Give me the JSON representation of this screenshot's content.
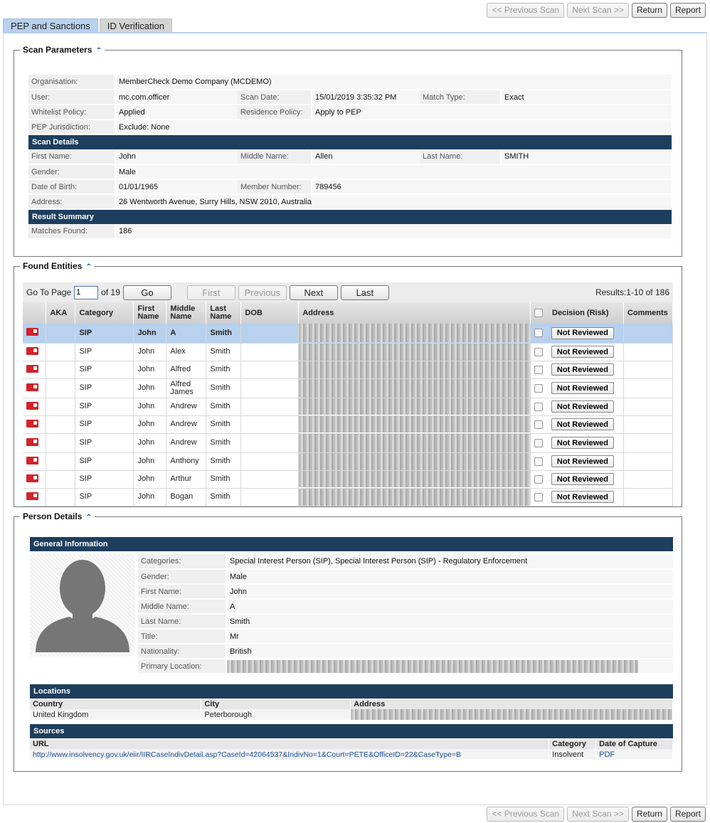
{
  "nav": {
    "previous_scan": "<< Previous Scan",
    "next_scan": "Next Scan >>",
    "return": "Return",
    "report": "Report"
  },
  "tabs": [
    {
      "label": "PEP and Sanctions",
      "active": true
    },
    {
      "label": "ID Verification",
      "active": false
    }
  ],
  "scan_parameters": {
    "legend": "Scan Parameters",
    "organisation_label": "Organisation:",
    "organisation": "MemberCheck Demo Company (MCDEMO)",
    "user_label": "User:",
    "user": "mc.com.officer",
    "scan_date_label": "Scan Date:",
    "scan_date": "15/01/2019 3:35:32 PM",
    "match_type_label": "Match Type:",
    "match_type": "Exact",
    "whitelist_label": "Whitelist Policy:",
    "whitelist": "Applied",
    "residence_label": "Residence Policy:",
    "residence": "Apply to PEP",
    "jurisdiction_label": "PEP Jurisdiction:",
    "jurisdiction": "Exclude: None",
    "scan_details_header": "Scan Details",
    "first_name_label": "First Name:",
    "first_name": "John",
    "middle_name_label": "Middle Name:",
    "middle_name": "Allen",
    "last_name_label": "Last Name:",
    "last_name": "SMITH",
    "gender_label": "Gender:",
    "gender": "Male",
    "dob_label": "Date of Birth:",
    "dob": "01/01/1965",
    "member_number_label": "Member Number:",
    "member_number": "789456",
    "address_label": "Address:",
    "address": "26 Wentworth Avenue, Surry Hills, NSW 2010, Australia",
    "result_summary_header": "Result Summary",
    "matches_label": "Matches Found:",
    "matches": "186"
  },
  "found_entities": {
    "legend": "Found Entities",
    "go_to_page_label": "Go To Page",
    "page_value": "1",
    "of_pages": "of 19",
    "go": "Go",
    "first": "First",
    "previous": "Previous",
    "next": "Next",
    "last": "Last",
    "results": "Results:1-10 of 186",
    "headers": {
      "aka": "AKA",
      "category": "Category",
      "first_name": "First Name",
      "middle_name": "Middle Name",
      "last_name": "Last Name",
      "dob": "DOB",
      "address": "Address",
      "decision": "Decision (Risk)",
      "comments": "Comments"
    },
    "decision_label": "Not Reviewed",
    "rows": [
      {
        "category": "SIP",
        "first": "John",
        "middle": "A",
        "last": "Smith"
      },
      {
        "category": "SIP",
        "first": "John",
        "middle": "Alex",
        "last": "Smith"
      },
      {
        "category": "SIP",
        "first": "John",
        "middle": "Alfred",
        "last": "Smith"
      },
      {
        "category": "SIP",
        "first": "John",
        "middle": "Alfred James",
        "last": "Smith"
      },
      {
        "category": "SIP",
        "first": "John",
        "middle": "Andrew",
        "last": "Smith"
      },
      {
        "category": "SIP",
        "first": "John",
        "middle": "Andrew",
        "last": "Smith"
      },
      {
        "category": "SIP",
        "first": "John",
        "middle": "Andrew",
        "last": "Smith"
      },
      {
        "category": "SIP",
        "first": "John",
        "middle": "Anthony",
        "last": "Smith"
      },
      {
        "category": "SIP",
        "first": "John",
        "middle": "Arthur",
        "last": "Smith"
      },
      {
        "category": "SIP",
        "first": "John",
        "middle": "Bogan",
        "last": "Smith"
      }
    ]
  },
  "person_details": {
    "legend": "Person Details",
    "general_header": "General Information",
    "categories_label": "Categories:",
    "categories": "Special Interest Person (SIP), Special Interest Person (SIP) - Regulatory Enforcement",
    "gender_label": "Gender:",
    "gender": "Male",
    "first_name_label": "First Name:",
    "first_name": "John",
    "middle_name_label": "Middle Name:",
    "middle_name": "A",
    "last_name_label": "Last Name:",
    "last_name": "Smith",
    "title_label": "Title:",
    "title": "Mr",
    "nationality_label": "Nationality:",
    "nationality": "British",
    "primary_location_label": "Primary Location:",
    "locations_header": "Locations",
    "loc_country_h": "Country",
    "loc_city_h": "City",
    "loc_address_h": "Address",
    "loc_country": "United Kingdom",
    "loc_city": "Peterborough",
    "sources_header": "Sources",
    "src_url_h": "URL",
    "src_category_h": "Category",
    "src_date_h": "Date of Capture",
    "src_url": "http://www.insolvency.gov.uk/eiir/IIRCaseIndivDetail.asp?CaseId=42064537&IndivNo=1&Court=PETE&OfficeID=22&CaseType=B",
    "src_category": "Insolvent",
    "src_date": "PDF"
  }
}
